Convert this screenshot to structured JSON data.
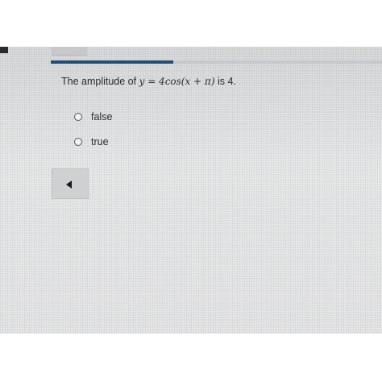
{
  "question": {
    "prefix": "The amplitude of ",
    "formula": "y = 4cos(x + π)",
    "suffix": " is 4."
  },
  "options": [
    {
      "label": "false",
      "selected": false
    },
    {
      "label": "true",
      "selected": false
    }
  ],
  "progress": {
    "fraction": 0.37
  },
  "navigation": {
    "back_icon": "back-arrow-icon"
  },
  "colors": {
    "progress_fill": "#1f4e79",
    "screen_background": "#dcdcdc",
    "text": "#2d2d2d"
  }
}
